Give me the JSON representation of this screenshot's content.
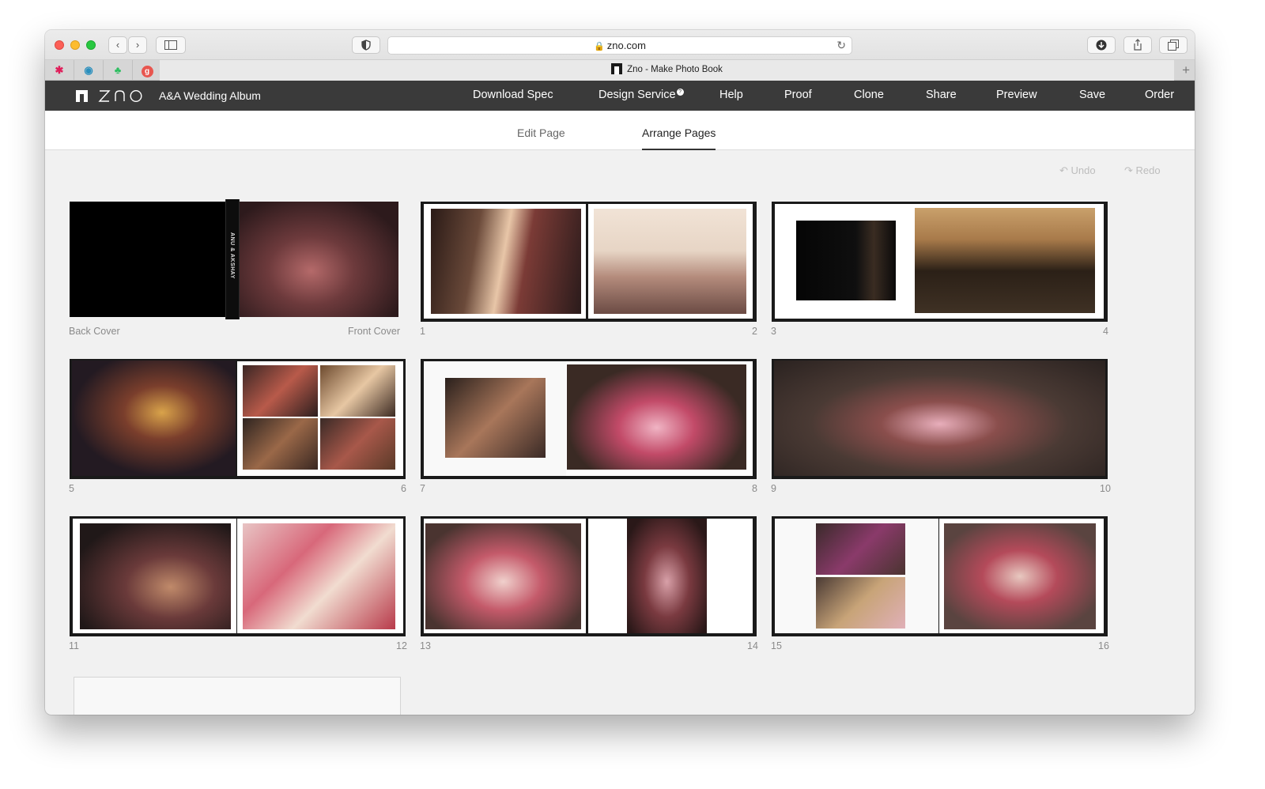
{
  "browser": {
    "url": "zno.com",
    "tab_title": "Zno - Make Photo Book",
    "new_tab": "+"
  },
  "app": {
    "logo_text": "ZNO",
    "album_title": "A&A Wedding Album",
    "nav": {
      "download_spec": "Download Spec",
      "design_service": "Design Service",
      "help": "Help",
      "proof": "Proof",
      "clone": "Clone",
      "share": "Share",
      "preview": "Preview",
      "save": "Save",
      "order": "Order"
    },
    "design_service_badge": "?",
    "subtabs": {
      "edit": "Edit Page",
      "arrange": "Arrange Pages"
    },
    "undo": "Undo",
    "redo": "Redo",
    "spine_text": "ANU & AKSHAY"
  },
  "spreads": [
    {
      "left": "Back Cover",
      "right": "Front Cover"
    },
    {
      "left": "1",
      "right": "2"
    },
    {
      "left": "3",
      "right": "4"
    },
    {
      "left": "5",
      "right": "6"
    },
    {
      "left": "7",
      "right": "8"
    },
    {
      "left": "9",
      "right": "10"
    },
    {
      "left": "11",
      "right": "12"
    },
    {
      "left": "13",
      "right": "14"
    },
    {
      "left": "15",
      "right": "16"
    }
  ],
  "colors": {
    "header_bg": "#3a3a3a",
    "canvas_bg": "#f1f1f1",
    "accent": "#333333"
  }
}
